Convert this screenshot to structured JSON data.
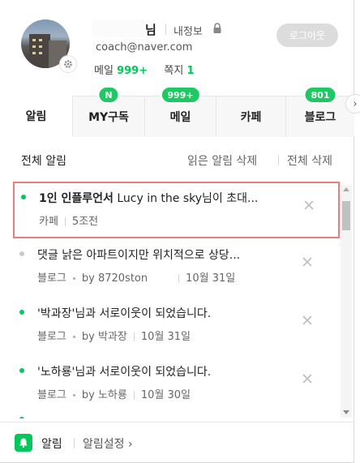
{
  "profile": {
    "name_suffix": "님",
    "my_info": "내정보",
    "email": "coach@naver.com",
    "mail_label": "메일",
    "mail_count": "999+",
    "note_label": "쪽지",
    "note_count": "1",
    "logout": "로그아웃"
  },
  "tabs": [
    {
      "label": "알림",
      "badge": ""
    },
    {
      "label": "MY구독",
      "badge": "N"
    },
    {
      "label": "메일",
      "badge": "999+"
    },
    {
      "label": "카페",
      "badge": ""
    },
    {
      "label": "블로그",
      "badge": "801"
    }
  ],
  "subheader": {
    "title": "전체 알림",
    "delete_read": "읽은 알림 삭제",
    "delete_all": "전체 삭제"
  },
  "notifications": [
    {
      "title_bold": "1인 인플루언서",
      "title_rest": " Lucy in the sky님이 초대...",
      "source": "카페",
      "by": "",
      "date": "5조전",
      "unread": true
    },
    {
      "title_bold": "",
      "title_rest": "댓글 낡은 아파트이지만 위치적으로 상당...",
      "source": "블로그",
      "by": "by 8720ston",
      "date": "10월 31일",
      "unread": false
    },
    {
      "title_bold": "",
      "title_rest": "'박과장'님과 서로이웃이 되었습니다.",
      "source": "블로그",
      "by": "by 박과장",
      "date": "10월 31일",
      "unread": true
    },
    {
      "title_bold": "",
      "title_rest": "'노하룡'님과 서로이웃이 되었습니다.",
      "source": "블로그",
      "by": "by 노하룡",
      "date": "10월 30일",
      "unread": true
    }
  ],
  "footer": {
    "label": "알림",
    "settings": "알림설정 ›"
  },
  "colors": {
    "accent": "#03c75a",
    "badge": "#1ec863",
    "highlight_border": "#e87d7d"
  }
}
